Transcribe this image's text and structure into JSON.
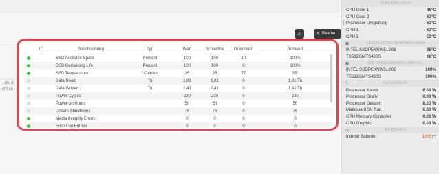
{
  "toolbar": {
    "warn_icon": "warning-icon",
    "edit_label": "Bearbe"
  },
  "left_fragments": [
    ", die d",
    "cht so"
  ],
  "table": {
    "columns": [
      "ID",
      "Beschreibung",
      "Typ",
      "Wert",
      "Schlechte",
      "Grenzwert",
      "Rohwert"
    ],
    "rows": [
      {
        "status": "green",
        "desc": "SSD Available Spare",
        "typ": "Percent",
        "wert": "100",
        "sch": "100",
        "gre": "10",
        "roh": "100%"
      },
      {
        "status": "green",
        "desc": "SSD Remaining Life",
        "typ": "Percent",
        "wert": "100",
        "sch": "100",
        "gre": "0",
        "roh": "100%"
      },
      {
        "status": "green",
        "desc": "SSD Temperature",
        "typ": "° Celsius",
        "wert": "35",
        "sch": "35",
        "gre": "77",
        "roh": "35°"
      },
      {
        "status": "none",
        "desc": "Data Read",
        "typ": "Tb",
        "wert": "1,81",
        "sch": "1,81",
        "gre": "0",
        "roh": "1,81 Tb"
      },
      {
        "status": "none",
        "desc": "Data Written",
        "typ": "Tb",
        "wert": "1,41",
        "sch": "1,41",
        "gre": "0",
        "roh": "1,41 Tb"
      },
      {
        "status": "none",
        "desc": "Power Cycles",
        "typ": "",
        "wert": "230",
        "sch": "230",
        "gre": "0",
        "roh": "230"
      },
      {
        "status": "none",
        "desc": "Power-on Hours",
        "typ": "",
        "wert": "50",
        "sch": "50",
        "gre": "0",
        "roh": "50"
      },
      {
        "status": "none",
        "desc": "Unsafe Shutdowns",
        "typ": "",
        "wert": "76",
        "sch": "76",
        "gre": "0",
        "roh": "76"
      },
      {
        "status": "green",
        "desc": "Media Integrity Errors",
        "typ": "",
        "wert": "0",
        "sch": "0",
        "gre": "0",
        "roh": "0"
      },
      {
        "status": "green",
        "desc": "Error Log Entries",
        "typ": "",
        "wert": "0",
        "sch": "0",
        "gre": "0",
        "roh": "0"
      }
    ]
  },
  "sidebar": {
    "sections": [
      {
        "icon": "",
        "title": "TEMPERATUREN",
        "rows": [
          {
            "label": "CPU Core 1",
            "value": "46°C"
          },
          {
            "label": "CPU Core 2",
            "value": "53°C"
          },
          {
            "label": "Prozessor-Umgebung",
            "value": "53°C"
          },
          {
            "label": "CPU 1",
            "value": "53°C"
          },
          {
            "label": "CPU 2",
            "value": "53°C"
          }
        ]
      },
      {
        "icon": "disk-icon",
        "title": "FESTPLATTEN-TEMPERATUREN",
        "rows": [
          {
            "label": "INTEL SSDPEKNW512G8",
            "value": "35°C"
          },
          {
            "label": "TS512GMTS430S",
            "value": "18°C"
          }
        ]
      },
      {
        "icon": "disk-icon",
        "title": "SSD VERBLEIBENDE LEBENS...",
        "rows": [
          {
            "label": "INTEL SSDPEKNW512G8",
            "value": "100%"
          },
          {
            "label": "TS512GMTS430S",
            "value": "100%"
          }
        ]
      },
      {
        "icon": "bolt-icon",
        "title": "LEISTUNGEN",
        "rows": [
          {
            "label": "Prozessor Kerne",
            "value": "6.83 W"
          },
          {
            "label": "Prozessor Grafik",
            "value": "0.03 W"
          },
          {
            "label": "Prozessor Gesamt",
            "value": "8.20 W"
          },
          {
            "label": "Mainboard 5V Rail",
            "value": "6.83 W"
          },
          {
            "label": "CPU Memory Controller",
            "value": "0.03 W"
          },
          {
            "label": "CPU Graphic",
            "value": "0.03 W"
          }
        ]
      },
      {
        "icon": "battery-icon",
        "title": "BATTERIEN",
        "rows": [
          {
            "label": "Interne Batterie",
            "value": "10%",
            "orange": true
          }
        ]
      }
    ]
  }
}
